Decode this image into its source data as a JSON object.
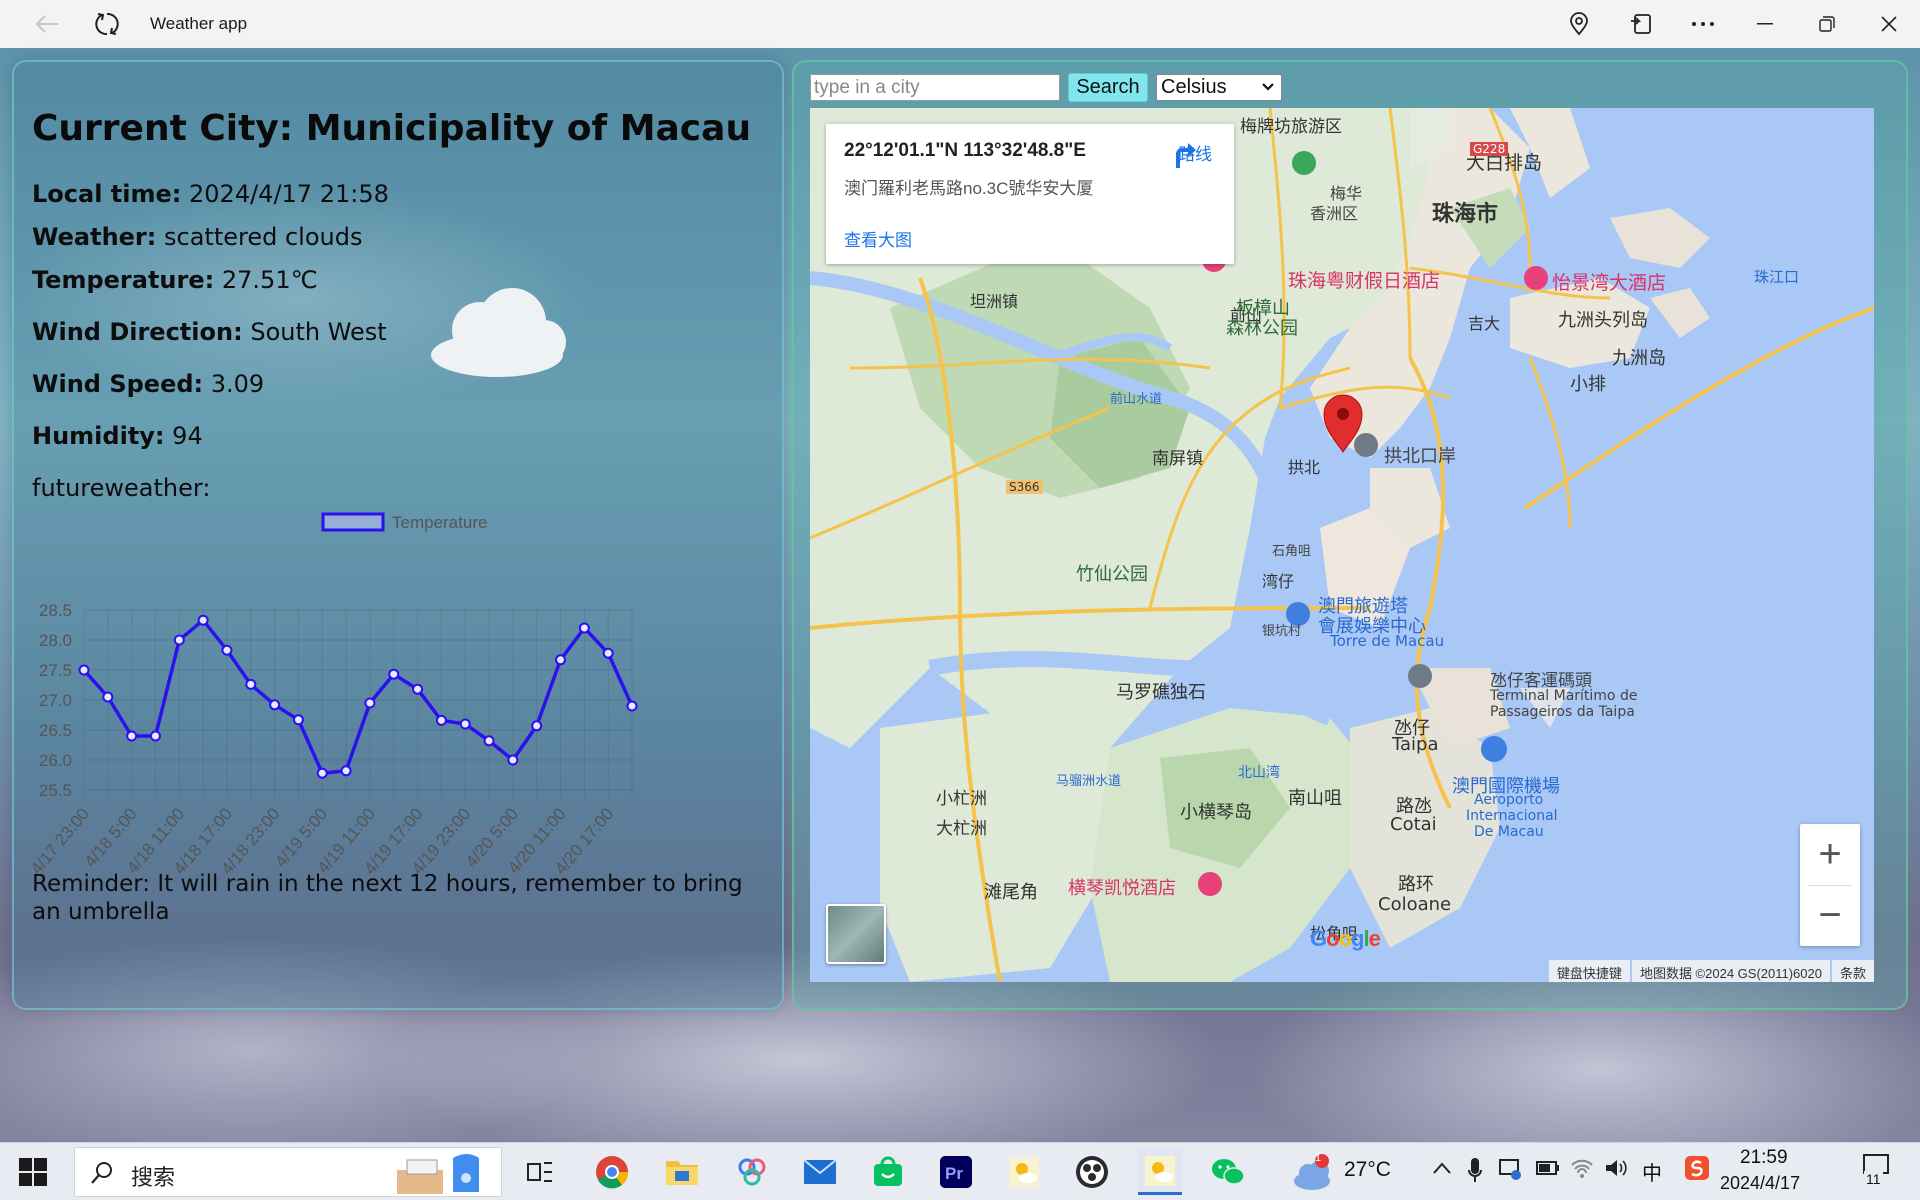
{
  "window": {
    "title": "Weather app"
  },
  "weather": {
    "city_title": "Current City: Municipality of Macau",
    "local_time_label": "Local time:",
    "local_time_value": "2024/4/17 21:58",
    "weather_label": "Weather:",
    "weather_value": "scattered clouds",
    "temperature_label": "Temperature:",
    "temperature_value": "27.51℃",
    "wind_dir_label": "Wind Direction:",
    "wind_dir_value": "South West",
    "wind_speed_label": "Wind Speed:",
    "wind_speed_value": "3.09",
    "humidity_label": "Humidity:",
    "humidity_value": "94",
    "future_label": "futureweather:",
    "reminder": "Reminder: It will rain in the next 12 hours, remember to bring an umbrella"
  },
  "chart_data": {
    "type": "line",
    "legend": "Temperature",
    "legend_position": "top",
    "grid": true,
    "y_ticks": [
      "28.5",
      "28.0",
      "27.5",
      "27.0",
      "26.5",
      "26.0",
      "25.5"
    ],
    "ylim": [
      25.5,
      28.5
    ],
    "x_tick_labels": [
      "4/17 23:00",
      "4/18 5:00",
      "4/18 11:00",
      "4/18 17:00",
      "4/18 23:00",
      "4/19 5:00",
      "4/19 11:00",
      "4/19 17:00",
      "4/19 23:00",
      "4/20 5:00",
      "4/20 11:00",
      "4/20 17:00"
    ],
    "series": [
      {
        "name": "Temperature",
        "color": "#2b10f0",
        "values": [
          27.5,
          27.05,
          26.4,
          26.4,
          28.0,
          28.33,
          27.83,
          27.26,
          26.92,
          26.67,
          25.78,
          25.82,
          26.95,
          27.43,
          27.18,
          26.66,
          26.6,
          26.32,
          26.0,
          26.57,
          27.67,
          28.2,
          27.78,
          26.9
        ]
      }
    ]
  },
  "controls": {
    "search_placeholder": "type in a city",
    "search_button": "Search",
    "unit_selected": "Celsius"
  },
  "map": {
    "info_card": {
      "coordinates": "22°12'01.1\"N 113°32'48.8\"E",
      "address": "澳门羅利老馬路no.3C號华安大厦",
      "view_larger": "查看大图",
      "route": "路线"
    },
    "labels": [
      "珠海市",
      "大白排岛",
      "梅华",
      "香洲区",
      "前山",
      "坦洲镇",
      "南屏镇",
      "拱北",
      "拱北口岸",
      "竹仙公园",
      "澳門旅遊塔",
      "會展娛樂中心",
      "Torre de Macau",
      "马罗礁独石",
      "氹仔",
      "Taipa",
      "氹仔客運碼頭",
      "Terminal Marítimo de",
      "Passageiros da Taipa",
      "澳門國際機場",
      "Aeroporto",
      "Internacional",
      "De Macau",
      "小杧洲",
      "大杧洲",
      "小横琴岛",
      "南山咀",
      "路氹",
      "Cotai",
      "路环",
      "Coloane",
      "滩尾角",
      "横琴凯悦酒店",
      "珠海粤财假日酒店",
      "怡景湾大酒店",
      "板樟山",
      "森林公园",
      "九洲头列岛",
      "九洲岛",
      "小排",
      "吉大",
      "珠江口",
      "湾仔",
      "石角咀",
      "银坑村",
      "前山水道",
      "马骝洲水道",
      "北山湾",
      "松角咀",
      "梅牌坊旅游区",
      "S366",
      "G228"
    ],
    "attribution": [
      "键盘快捷键",
      "地图数据 ©2024 GS(2011)6020",
      "条款"
    ],
    "google": "Google"
  },
  "taskbar": {
    "search_label": "搜索",
    "weather_temp": "27°C",
    "weather_badge": "1",
    "clock_time": "21:59",
    "clock_date": "2024/4/17",
    "notification_count": "11",
    "ime": "中"
  }
}
